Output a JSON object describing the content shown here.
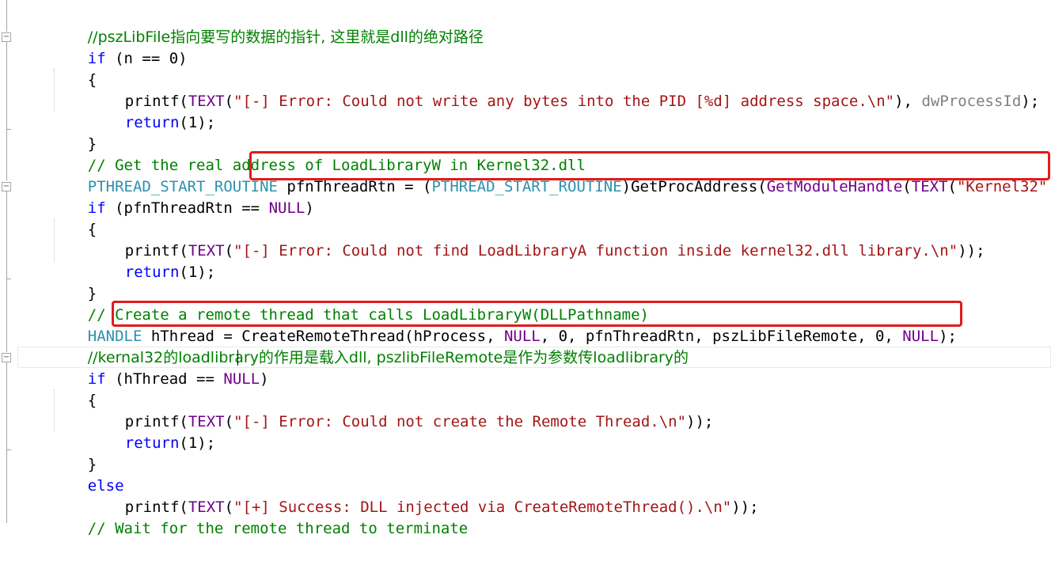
{
  "highlight_color": "#e11b1b",
  "code": {
    "l0": {
      "cm": "//pszLibFile指向要写的数据的指针, 这里就是dll的绝对路径"
    },
    "l1": {
      "kw": "if",
      "rest": " (n == 0)"
    },
    "l2": {
      "text": "{"
    },
    "l3": {
      "fn": "printf(",
      "mc": "TEXT",
      "p1": "(",
      "st": "\"[-] Error: Could not write any bytes into the PID [%d] address space.\\n\"",
      "p2": "), ",
      "pa": "dwProcessId",
      "p3": ");"
    },
    "l4": {
      "kw": "return",
      "rest": "(1);"
    },
    "l5": {
      "text": "}"
    },
    "l6": {
      "cm": "// Get the real address of LoadLibraryW in Kernel32.dll"
    },
    "l7": {
      "ty": "PTHREAD_START_ROUTINE",
      "p1": " pfnThreadRtn = (",
      "ty2": "PTHREAD_START_ROUTINE",
      "p2": ")GetProcAddress(",
      "mc": "GetModuleHandle",
      "p3": "(",
      "mc2": "TEXT",
      "p4": "(",
      "st": "\"Kernel32\""
    },
    "l8": {
      "kw": "if",
      "p1": " (pfnThreadRtn == ",
      "mc": "NULL",
      "p2": ")"
    },
    "l9": {
      "text": "{"
    },
    "l10": {
      "fn": "printf(",
      "mc": "TEXT",
      "p1": "(",
      "st": "\"[-] Error: Could not find LoadLibraryA function inside kernel32.dll library.\\n\"",
      "p2": "));"
    },
    "l11": {
      "kw": "return",
      "rest": "(1);"
    },
    "l12": {
      "text": "}"
    },
    "l13": {
      "cm": "// Create a remote thread that calls LoadLibraryW(DLLPathname)"
    },
    "l14": {
      "ty": "HANDLE",
      "p1": " hThread = CreateRemoteThread(hProcess, ",
      "mc": "NULL",
      "p2": ", 0, pfnThreadRtn, pszLibFileRemote, 0, ",
      "mc2": "NULL",
      "p3": ");"
    },
    "l15": {
      "cm": "//kernal32的loadlibrary的作用是载入dll, pszlibFileRemote是作为参数传loadlibrary的"
    },
    "l16": {
      "kw": "if",
      "p1": " (hThread == ",
      "mc": "NULL",
      "p2": ")"
    },
    "l17": {
      "text": "{"
    },
    "l18": {
      "fn": "printf(",
      "mc": "TEXT",
      "p1": "(",
      "st": "\"[-] Error: Could not create the Remote Thread.\\n\"",
      "p2": "));"
    },
    "l19": {
      "kw": "return",
      "rest": "(1);"
    },
    "l20": {
      "text": "}"
    },
    "l21": {
      "kw": "else"
    },
    "l22": {
      "fn": "printf(",
      "mc": "TEXT",
      "p1": "(",
      "st": "\"[+] Success: DLL injected via CreateRemoteThread().\\n\"",
      "p2": "));"
    },
    "l23": {
      "cm": "// Wait for the remote thread to terminate"
    }
  }
}
